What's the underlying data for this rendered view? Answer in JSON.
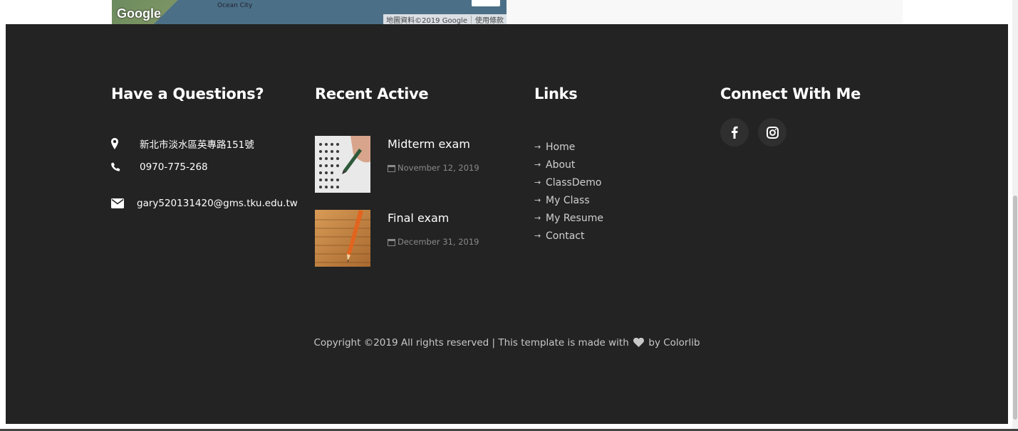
{
  "map": {
    "city_label": "Ocean City",
    "logo_text": "Google",
    "attribution": "地圖資料©2019 Google",
    "terms": "使用條款"
  },
  "footer": {
    "contact": {
      "title": "Have a Questions?",
      "address": "新北市淡水區英專路151號",
      "phone": "0970-775-268",
      "email": "gary520131420@gms.tku.edu.tw",
      "icons": [
        "map-marker-icon",
        "phone-icon",
        "envelope-icon"
      ]
    },
    "recent": {
      "title": "Recent Active",
      "posts": [
        {
          "title": "Midterm exam",
          "date": "November 12, 2019",
          "image": "exam-answer-sheet"
        },
        {
          "title": "Final exam",
          "date": "December 31, 2019",
          "image": "pencil-on-paper"
        }
      ]
    },
    "links": {
      "title": "Links",
      "items": [
        "Home",
        "About",
        "ClassDemo",
        "My Class",
        "My Resume",
        "Contact"
      ]
    },
    "connect": {
      "title": "Connect With Me",
      "icons": [
        "facebook-icon",
        "instagram-icon"
      ]
    },
    "copyright": {
      "before": "Copyright ©2019 All rights reserved | This template is made with",
      "after": "by Colorlib"
    }
  },
  "colors": {
    "footer_bg": "#232323",
    "text": "#ffffff",
    "muted": "#8a8a8a",
    "social_bg": "#2f2f2f"
  }
}
